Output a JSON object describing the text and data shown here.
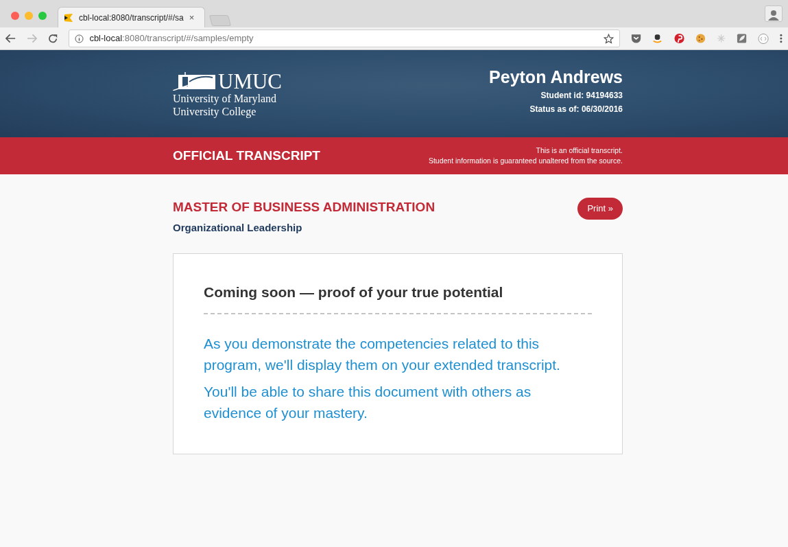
{
  "browser": {
    "tab_title": "cbl-local:8080/transcript/#/sa",
    "tab_close": "×",
    "url_host": "cbl-local",
    "url_path": ":8080/transcript/#/samples/empty"
  },
  "header": {
    "logo_word": "UMUC",
    "logo_lines": [
      "University of Maryland",
      "University College"
    ],
    "student_name": "Peyton Andrews",
    "student_id": "Student id: 94194633",
    "status": "Status as of: 06/30/2016"
  },
  "banner": {
    "title": "OFFICIAL TRANSCRIPT",
    "notes": [
      "This is an official transcript.",
      "Student information is guaranteed unaltered from the source."
    ]
  },
  "program": {
    "degree": "MASTER OF BUSINESS ADMINISTRATION",
    "specialization": "Organizational Leadership",
    "print_button": "Print »"
  },
  "notice": {
    "heading": "Coming soon — proof of your true potential",
    "paragraphs": [
      "As you demonstrate the competencies related to this program, we'll display them on your extended transcript.",
      "You'll be able to share this document with others as evidence of your mastery."
    ]
  }
}
